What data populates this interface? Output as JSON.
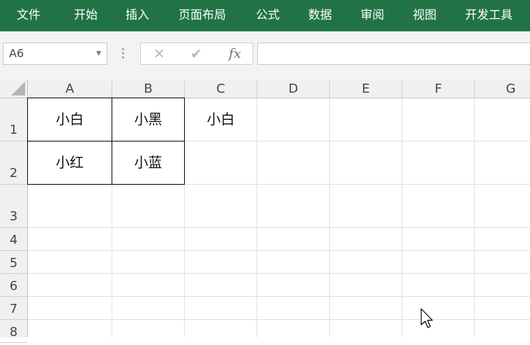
{
  "ribbon": {
    "tabs": [
      "文件",
      "开始",
      "插入",
      "页面布局",
      "公式",
      "数据",
      "审阅",
      "视图",
      "开发工具"
    ]
  },
  "formula_bar": {
    "name_box": "A6",
    "cancel_icon": "close-icon",
    "enter_icon": "check-icon",
    "function_label": "fx",
    "formula_value": ""
  },
  "sheet": {
    "columns": [
      "A",
      "B",
      "C",
      "D",
      "E",
      "F",
      "G"
    ],
    "rows": [
      "1",
      "2",
      "3",
      "4",
      "5",
      "6",
      "7",
      "8"
    ],
    "cells": {
      "A1": "小白",
      "B1": "小黑",
      "C1": "小白",
      "A2": "小红",
      "B2": "小蓝"
    }
  }
}
